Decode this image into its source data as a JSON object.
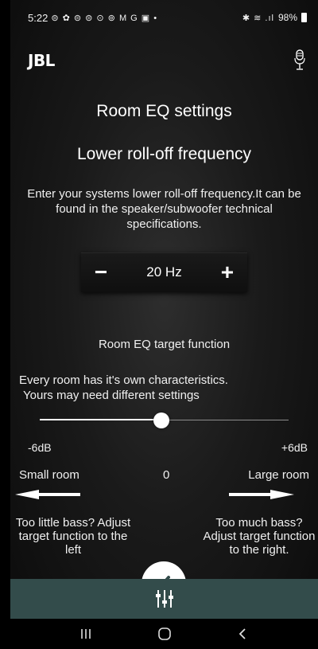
{
  "status_bar": {
    "time": "5:22",
    "notification_icons": "⊜ ✿ ⊜ ⊜ ⊙ ⊚ M G ▣ •",
    "system_icons": "✱ ≋ .ıl",
    "battery_percent": "98%"
  },
  "app_bar": {
    "logo_text": "JBL",
    "mic_icon": "microphone-icon"
  },
  "page": {
    "title": "Room EQ settings",
    "subtitle": "Lower roll-off frequency",
    "description": "Enter your systems lower roll-off frequency.It can be found in the speaker/subwoofer technical specifications."
  },
  "frequency_stepper": {
    "decrement_label": "−",
    "value": "20 Hz",
    "increment_label": "+"
  },
  "target_function": {
    "heading": "Room EQ target function",
    "description_line1": "Every room has it's own characteristics.",
    "description_line2": "Yours may need different settings",
    "slider_position": 0.49,
    "min_label": "-6dB",
    "max_label": "+6dB",
    "small_room_label": "Small room",
    "center_label": "0",
    "large_room_label": "Large room",
    "hint_left": "Too little bass? Adjust target function to the left",
    "hint_right": "Too much bass? Adjust target function to the right."
  },
  "bottom_bar": {
    "icon": "equalizer-icon"
  },
  "nav_bar": {
    "recents": "recents-icon",
    "home": "home-icon",
    "back": "back-icon"
  },
  "colors": {
    "bottom_bar": "#334c4b",
    "text": "#ffffff",
    "background": "#1a1a1a"
  }
}
